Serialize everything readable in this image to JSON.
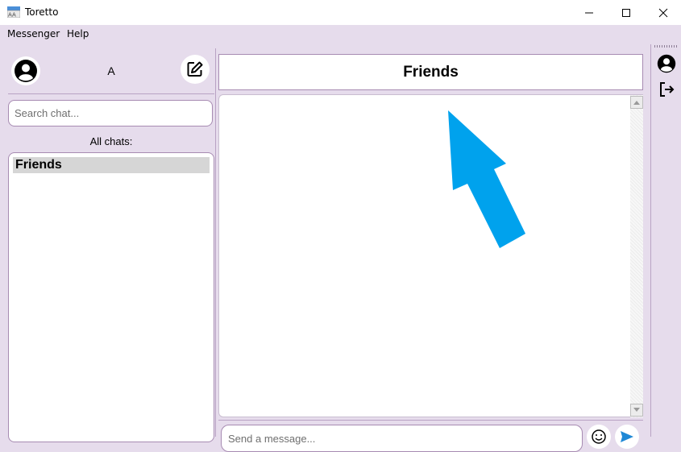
{
  "window": {
    "title": "Toretto"
  },
  "menu": {
    "items": [
      "Messenger",
      "Help"
    ]
  },
  "user": {
    "name": "A"
  },
  "search": {
    "placeholder": "Search chat..."
  },
  "chats": {
    "heading": "All chats:",
    "items": [
      {
        "name": "Friends",
        "selected": true
      }
    ]
  },
  "chat": {
    "title": "Friends"
  },
  "composer": {
    "placeholder": "Send a message..."
  },
  "colors": {
    "background": "#e6dcec",
    "border": "#a78bb2",
    "arrow": "#00a2ed",
    "send": "#1f88d6"
  },
  "icons": [
    "app-icon",
    "minimize-icon",
    "maximize-icon",
    "close-icon",
    "avatar-icon",
    "compose-icon",
    "scroll-up-icon",
    "scroll-down-icon",
    "emoji-icon",
    "send-icon",
    "profile-icon",
    "logout-icon",
    "arrow-icon"
  ]
}
